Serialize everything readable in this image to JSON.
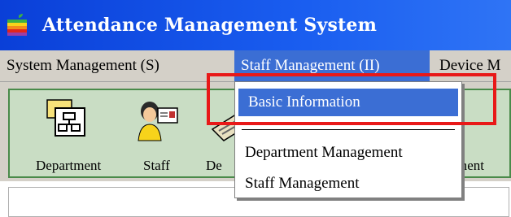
{
  "window": {
    "title": "Attendance Management System"
  },
  "menubar": {
    "items": [
      {
        "label": "System Management (S)"
      },
      {
        "label": "Staff Management (II)"
      },
      {
        "label": "Device M"
      }
    ]
  },
  "toolbar": {
    "tools": [
      {
        "label": "Department",
        "icon": "department-icon"
      },
      {
        "label": "Staff",
        "icon": "staff-icon"
      },
      {
        "label": "De",
        "icon": "device-icon"
      },
      {
        "label": "ment",
        "icon": ""
      }
    ]
  },
  "dropdown": {
    "items": [
      {
        "label": "Basic Information"
      },
      {
        "label": "Department Management"
      },
      {
        "label": "Staff Management"
      }
    ]
  },
  "colors": {
    "titlebar": "#0a3fd8",
    "menu_highlight": "#3b6ed4",
    "highlight_box": "#e81818",
    "toolbar_bg": "#c9ddc4"
  }
}
